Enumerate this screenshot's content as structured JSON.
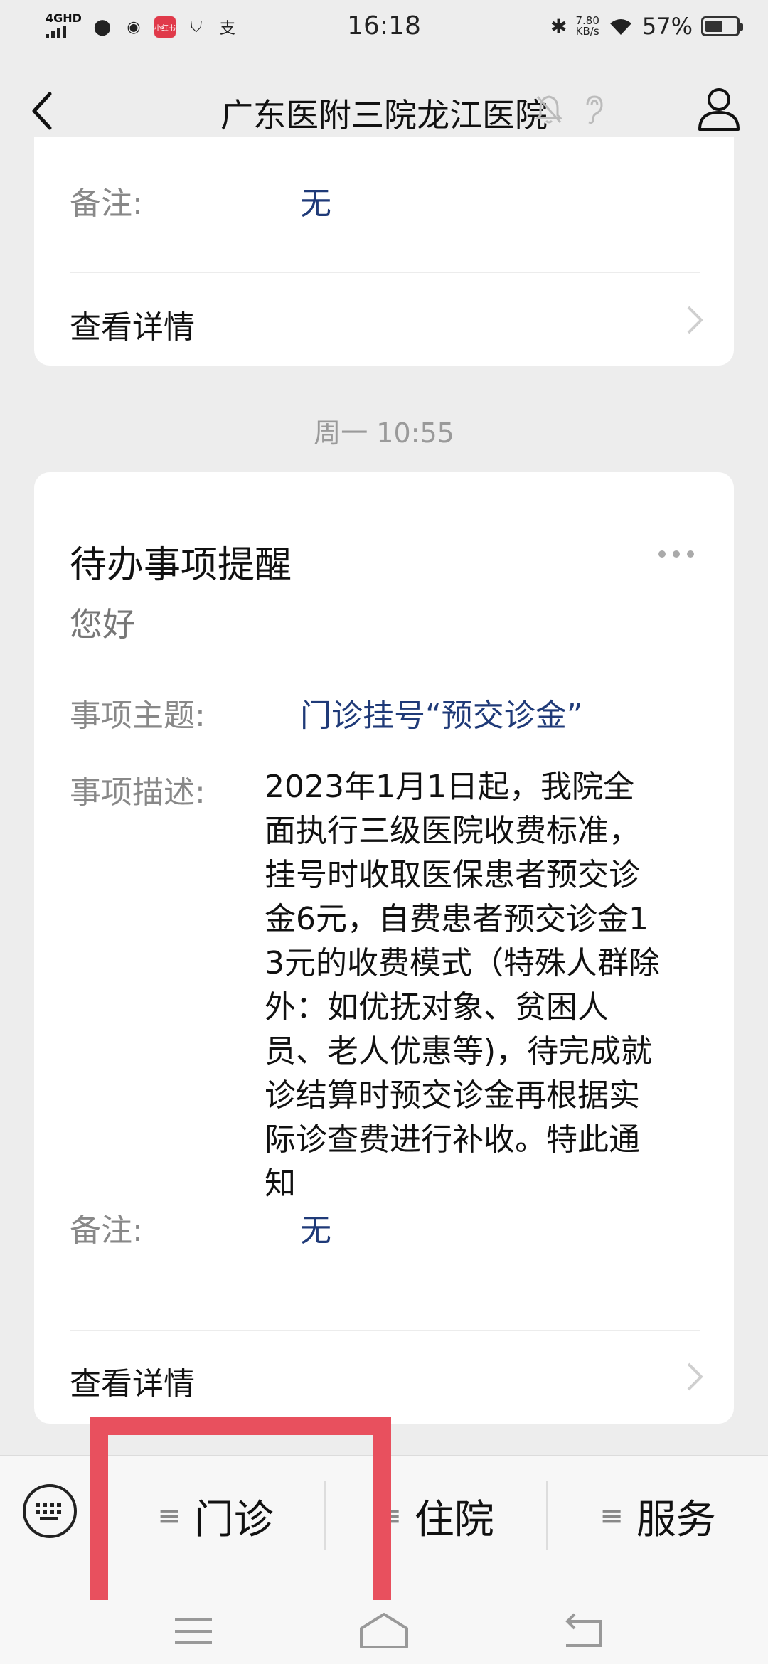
{
  "status_bar": {
    "network": "4GHD",
    "time": "16:18",
    "speed_value": "7.80",
    "speed_unit": "KB/s",
    "battery": "57%",
    "battery_level": 0.57,
    "badge_text": "小红书"
  },
  "nav": {
    "title": "广东医附三院龙江医院",
    "icons": [
      "back-icon",
      "bell-muted-icon",
      "ear-icon",
      "person-icon"
    ]
  },
  "card1": {
    "remark_label": "备注:",
    "remark_value": "无",
    "detail_label": "查看详情"
  },
  "timestamp": "周一 10:55",
  "card2": {
    "title": "待办事项提醒",
    "greeting": "您好",
    "subject_label": "事项主题:",
    "subject_value": "门诊挂号“预交诊金”",
    "desc_label": "事项描述:",
    "desc_value": "2023年1月1日起，我院全面执行三级医院收费标准，挂号时收取医保患者预交诊金6元，自费患者预交诊金13元的收费模式（特殊人群除外：如优抚对象、贫困人员、老人优惠等)，待完成就诊结算时预交诊金再根据实际诊查费进行补收。特此通知",
    "remark_label": "备注:",
    "remark_value": "无",
    "detail_label": "查看详情"
  },
  "menu": {
    "items": [
      {
        "label": "门诊"
      },
      {
        "label": "住院"
      },
      {
        "label": "服务"
      }
    ]
  },
  "colors": {
    "background": "#ededed",
    "value_blue": "#1f3a78",
    "highlight_red": "#e8505e"
  }
}
